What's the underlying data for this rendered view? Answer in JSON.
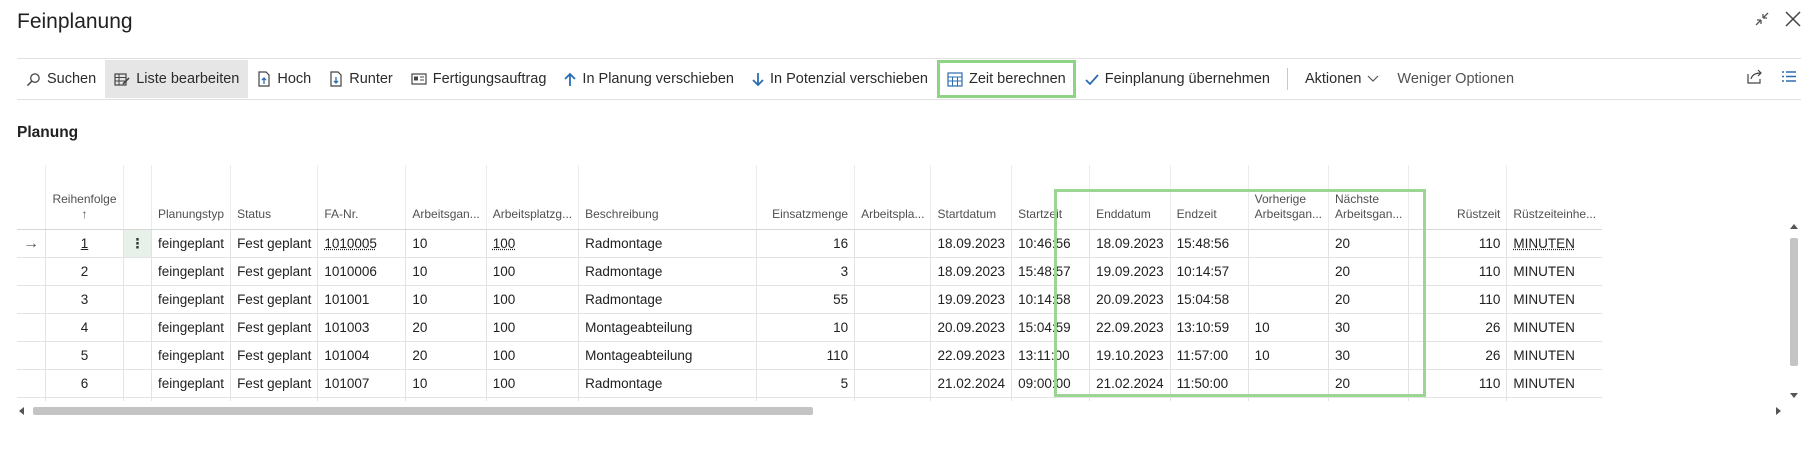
{
  "window": {
    "title": "Feinplanung"
  },
  "toolbar": {
    "items": [
      {
        "label": "Suchen",
        "icon": "search-icon"
      },
      {
        "label": "Liste bearbeiten",
        "icon": "edit-list-icon"
      },
      {
        "label": "Hoch",
        "icon": "document-up-icon"
      },
      {
        "label": "Runter",
        "icon": "document-down-icon"
      },
      {
        "label": "Fertigungsauftrag",
        "icon": "card-icon"
      },
      {
        "label": "In Planung verschieben",
        "icon": "arrow-up-icon"
      },
      {
        "label": "In Potenzial verschieben",
        "icon": "arrow-down-icon"
      },
      {
        "label": "Zeit berechnen",
        "icon": "calculator-icon"
      },
      {
        "label": "Feinplanung übernehmen",
        "icon": "checkmark-icon"
      }
    ],
    "actions_label": "Aktionen",
    "fewer_options_label": "Weniger Optionen"
  },
  "section": {
    "title": "Planung"
  },
  "table": {
    "columns": [
      {
        "label": "Reihenfolge",
        "sort": "↑"
      },
      {
        "label": "Planungstyp"
      },
      {
        "label": "Status"
      },
      {
        "label": "FA-Nr."
      },
      {
        "label": "Arbeitsgan..."
      },
      {
        "label": "Arbeitsplatzg..."
      },
      {
        "label": "Beschreibung"
      },
      {
        "label": "Einsatzmenge"
      },
      {
        "label": "Arbeitspla..."
      },
      {
        "label": "Startdatum"
      },
      {
        "label": "Startzeit"
      },
      {
        "label": "Enddatum"
      },
      {
        "label": "Endzeit"
      },
      {
        "label": "Vorherige",
        "label2": "Arbeitsgan..."
      },
      {
        "label": "Nächste",
        "label2": "Arbeitsgan..."
      },
      {
        "label": "Rüstzeit"
      },
      {
        "label": "Rüstzeiteinhe..."
      }
    ],
    "rows": [
      [
        "1",
        "feingeplant",
        "Fest geplant",
        "1010005",
        "10",
        "100",
        "Radmontage",
        "16",
        "",
        "18.09.2023",
        "10:46:56",
        "18.09.2023",
        "15:48:56",
        "",
        "20",
        "110",
        "MINUTEN"
      ],
      [
        "2",
        "feingeplant",
        "Fest geplant",
        "1010006",
        "10",
        "100",
        "Radmontage",
        "3",
        "",
        "18.09.2023",
        "15:48:57",
        "19.09.2023",
        "10:14:57",
        "",
        "20",
        "110",
        "MINUTEN"
      ],
      [
        "3",
        "feingeplant",
        "Fest geplant",
        "101001",
        "10",
        "100",
        "Radmontage",
        "55",
        "",
        "19.09.2023",
        "10:14:58",
        "20.09.2023",
        "15:04:58",
        "",
        "20",
        "110",
        "MINUTEN"
      ],
      [
        "4",
        "feingeplant",
        "Fest geplant",
        "101003",
        "20",
        "100",
        "Montageabteilung",
        "10",
        "",
        "20.09.2023",
        "15:04:59",
        "22.09.2023",
        "13:10:59",
        "10",
        "30",
        "26",
        "MINUTEN"
      ],
      [
        "5",
        "feingeplant",
        "Fest geplant",
        "101004",
        "20",
        "100",
        "Montageabteilung",
        "110",
        "",
        "22.09.2023",
        "13:11:00",
        "19.10.2023",
        "11:57:00",
        "10",
        "30",
        "26",
        "MINUTEN"
      ],
      [
        "6",
        "feingeplant",
        "Fest geplant",
        "101007",
        "10",
        "100",
        "Radmontage",
        "5",
        "",
        "21.02.2024",
        "09:00:00",
        "21.02.2024",
        "11:50:00",
        "",
        "20",
        "110",
        "MINUTEN"
      ]
    ]
  },
  "colors": {
    "highlight": "#8fd486",
    "accent": "#00856f"
  }
}
